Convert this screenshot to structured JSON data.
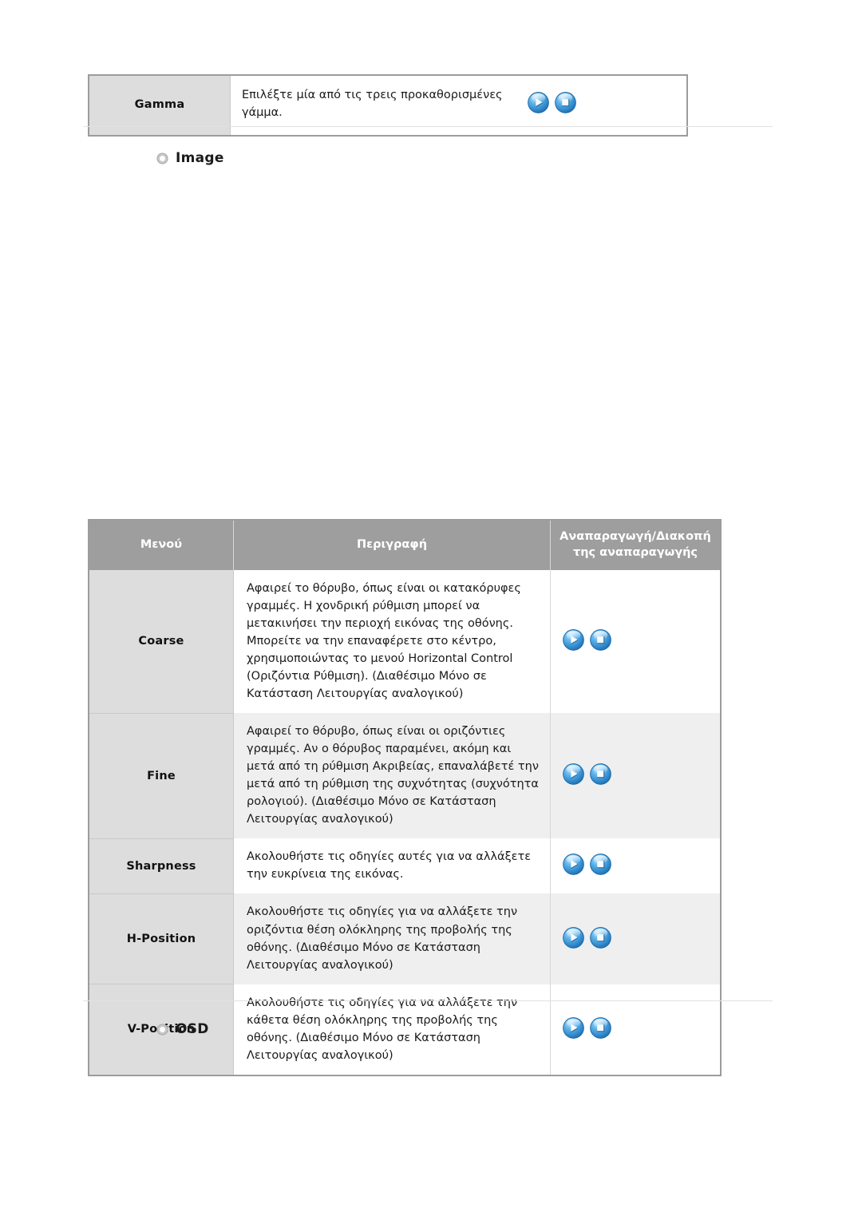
{
  "gamma_table": {
    "rows": [
      {
        "menu": "Gamma",
        "description": "Επιλέξτε μία από τις τρεις προκαθορισμένες γάμμα.",
        "play_icon": "play-button-icon",
        "stop_icon": "stop-button-icon"
      }
    ]
  },
  "sections": {
    "image": {
      "bullet_icon": "arrow-circle-bullet-icon",
      "title": "Image"
    },
    "osd": {
      "bullet_icon": "arrow-circle-bullet-icon",
      "title": "OSD"
    }
  },
  "image_table": {
    "headers": {
      "menu": "Μενού",
      "description": "Περιγραφή",
      "playback": "Αναπαραγωγή/Διακοπή της αναπαραγωγής"
    },
    "rows": [
      {
        "menu": "Coarse",
        "description": "Αφαιρεί το θόρυβο, όπως είναι οι κατακόρυφες γραμμές. Η χονδρική ρύθμιση μπορεί να μετακινήσει την περιοχή εικόνας της οθόνης.\nΜπορείτε να την επαναφέρετε στο κέντρο, χρησιμοποιώντας το μενού Horizontal Control (Οριζόντια Ρύθμιση).\n(Διαθέσιμο Μόνο σε Κατάσταση Λειτουργίας αναλογικού)",
        "play_icon": "play-button-icon",
        "stop_icon": "stop-button-icon",
        "shade": "white"
      },
      {
        "menu": "Fine",
        "description": "Αφαιρεί το θόρυβο, όπως είναι οι οριζόντιες γραμμές. Αν ο θόρυβος παραμένει, ακόμη και μετά από τη ρύθμιση Ακριβείας, επαναλάβετέ την μετά από τη ρύθμιση της συχνότητας (συχνότητα ρολογιού).\n(Διαθέσιμο Μόνο σε Κατάσταση Λειτουργίας αναλογικού)",
        "play_icon": "play-button-icon",
        "stop_icon": "stop-button-icon",
        "shade": "gray"
      },
      {
        "menu": "Sharpness",
        "description": "Ακολουθήστε τις οδηγίες αυτές για να αλλάξετε την ευκρίνεια της εικόνας.",
        "play_icon": "play-button-icon",
        "stop_icon": "stop-button-icon",
        "shade": "white"
      },
      {
        "menu": "H-Position",
        "description": "Ακολουθήστε τις οδηγίες για να αλλάξετε την οριζόντια θέση ολόκληρης της προβολής της οθόνης.\n(Διαθέσιμο Μόνο σε Κατάσταση Λειτουργίας αναλογικού)",
        "play_icon": "play-button-icon",
        "stop_icon": "stop-button-icon",
        "shade": "gray"
      },
      {
        "menu": "V-Position",
        "description": "Ακολουθήστε τις οδηγίες για να αλλάξετε την κάθετα θέση ολόκληρης της προβολής της οθόνης.\n(Διαθέσιμο Μόνο σε Κατάσταση Λειτουργίας αναλογικού)",
        "play_icon": "play-button-icon",
        "stop_icon": "stop-button-icon",
        "shade": "white"
      }
    ]
  },
  "colors": {
    "header_gray": "#9e9e9e",
    "menu_cell_gray": "#dddddd",
    "row_alt_gray": "#efefef",
    "table_border": "#9c9c9c",
    "rule_gray": "#e2e2e2",
    "button_blue": "#2f8ed6"
  }
}
